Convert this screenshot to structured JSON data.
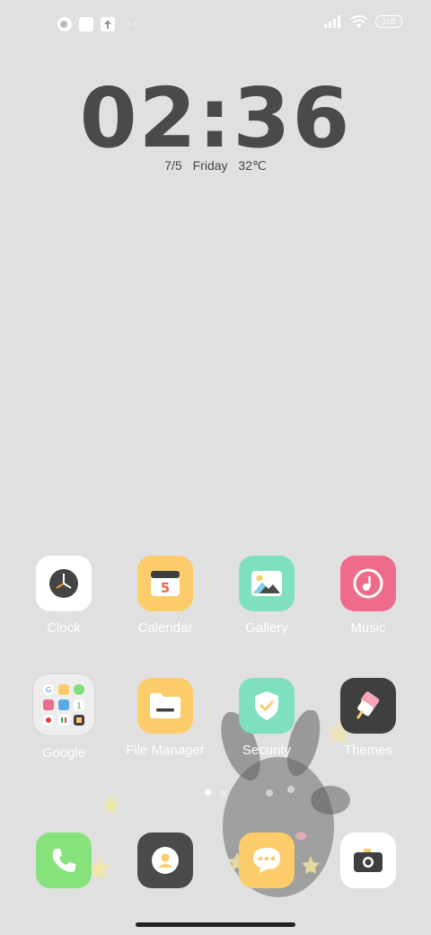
{
  "status_bar": {
    "battery": "100",
    "overflow": "··"
  },
  "clock_widget": {
    "time": "02:36",
    "date": "7/5",
    "day": "Friday",
    "temperature": "32℃"
  },
  "apps_row1": [
    {
      "label": "Clock",
      "icon": "clock-icon"
    },
    {
      "label": "Calendar",
      "icon": "calendar-icon",
      "badge": "5"
    },
    {
      "label": "Gallery",
      "icon": "gallery-icon"
    },
    {
      "label": "Music",
      "icon": "music-icon"
    }
  ],
  "apps_row2": [
    {
      "label": "Google",
      "icon": "google-folder-icon"
    },
    {
      "label": "File Manager",
      "icon": "folder-icon"
    },
    {
      "label": "Security",
      "icon": "shield-check-icon"
    },
    {
      "label": "Themes",
      "icon": "brush-icon"
    }
  ],
  "dock": [
    {
      "name": "phone",
      "icon": "phone-icon"
    },
    {
      "name": "contacts",
      "icon": "contacts-icon"
    },
    {
      "name": "messages",
      "icon": "message-icon"
    },
    {
      "name": "camera",
      "icon": "camera-icon"
    }
  ],
  "colors": {
    "background": "#e0e0e0",
    "calendar": "#fccc6a",
    "gallery": "#7fe0bd",
    "music": "#ef6b8a",
    "themes": "#3f3f3f",
    "phone": "#88e27c",
    "contacts": "#4a4a4a",
    "messages": "#fccc6a"
  }
}
